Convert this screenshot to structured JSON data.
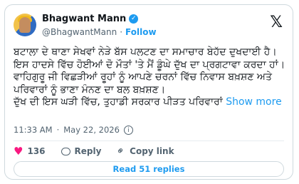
{
  "author": {
    "display_name": "Bhagwant Mann",
    "handle": "@BhagwantMann",
    "separator": "·",
    "follow_label": "Follow"
  },
  "tweet": {
    "text": "ਬਟਾਲਾ ਦੇ ਥਾਣਾ ਸੇਖਵਾਂ ਨੇੜੇ ਬੱਸ ਪਲਟਣ ਦਾ ਸਮਾਚਾਰ ਬੇਹੱਦ ਦੁਖਦਾਈ ਹੈ। ਇਸ ਹਾਦਸੇ ਵਿੱਚ ਹੋਈਆਂ ਦੋ ਮੌਤਾਂ 'ਤੇ ਮੈਂ ਡੂੰਘੇ ਦੁੱਖ ਦਾ ਪ੍ਰਗਟਾਵਾ ਕਰਦਾ ਹਾਂ। ਵਾਹਿਗੁਰੂ ਜੀ ਵਿਛੜੀਆਂ ਰੂਹਾਂ ਨੂੰ ਆਪਣੇ ਚਰਨਾਂ ਵਿੱਚ ਨਿਵਾਸ ਬਖ਼ਸ਼ਣ ਅਤੇ ਪਰਿਵਾਰਾਂ ਨੂੰ ਭਾਣਾ ਮੰਨਣ ਦਾ ਬਲ ਬਖ਼ਸ਼ਣ।\nਦੁੱਖ ਦੀ ਇਸ ਘੜੀ ਵਿੱਚ, ਤੁਹਾਡੀ ਸਰਕਾਰ ਪੀੜਤ ਪਰਿਵਾਰਾਂ",
    "show_more": "Show more",
    "time": "11:33 AM",
    "dot": "·",
    "date": "May 22, 2026"
  },
  "actions": {
    "like_count": "136",
    "reply_label": "Reply",
    "copy_link_label": "Copy link"
  },
  "read_replies_label": "Read 51 replies",
  "colors": {
    "accent": "#1d9bf0",
    "like": "#f91880",
    "secondary_text": "#536471",
    "border": "#cfd9de"
  }
}
